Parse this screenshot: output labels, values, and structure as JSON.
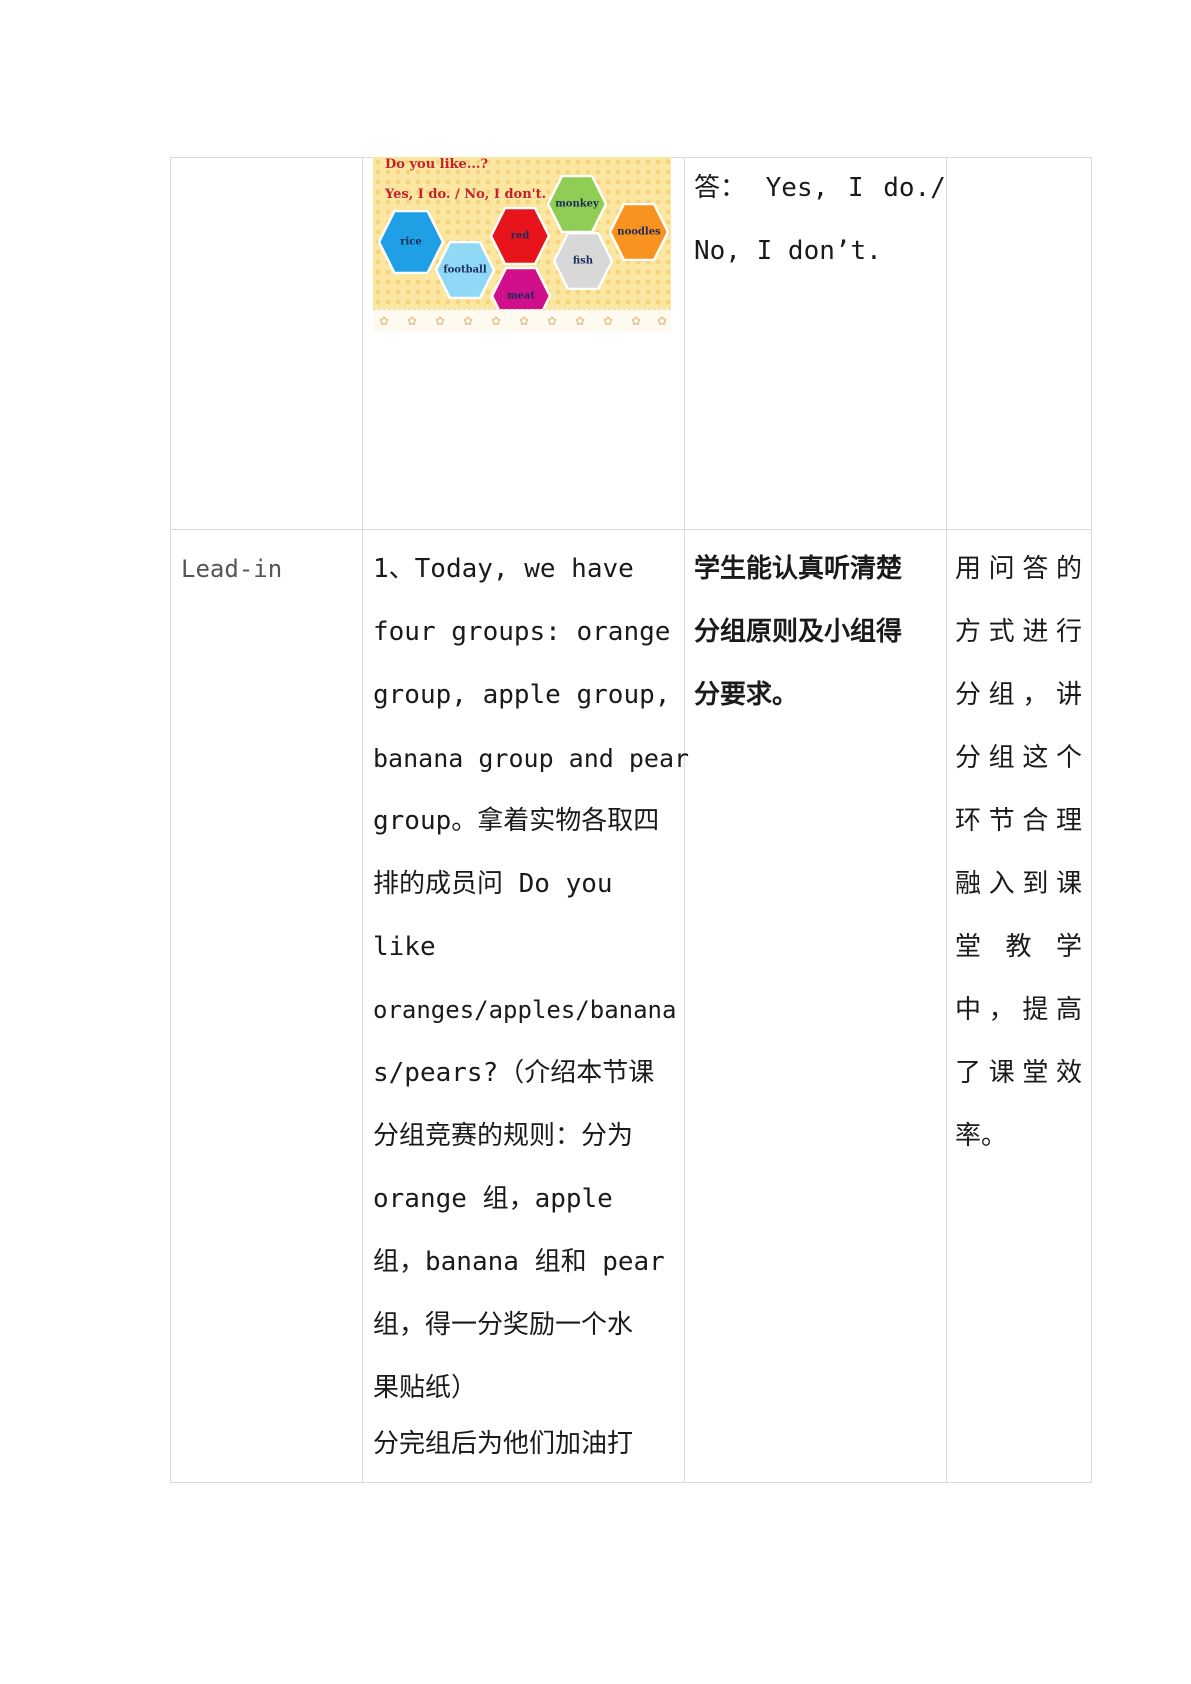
{
  "table": {
    "row1": {
      "slide": {
        "question": "Do you like...?",
        "answers_line": "Yes, I do. / No, I don't.",
        "hexagons": [
          {
            "label": "rice",
            "color": "#1e9fe6"
          },
          {
            "label": "football",
            "color": "#8fd8f6"
          },
          {
            "label": "red",
            "color": "#e8141c"
          },
          {
            "label": "meat",
            "color": "#d10f8a"
          },
          {
            "label": "monkey",
            "color": "#8fcd55"
          },
          {
            "label": "fish",
            "color": "#d8d8d8"
          },
          {
            "label": "noodles",
            "color": "#f7931e"
          }
        ]
      },
      "col3_lines": [
        "答： Yes,  I  do./",
        "No, I don’t."
      ]
    },
    "row2": {
      "stage": "Lead-in",
      "activity_lines": [
        "1、Today,  we  have",
        "four groups: orange",
        "group,  apple group,",
        "banana group and pear",
        "group。拿着实物各取四",
        "排的成员问 Do  you",
        "like",
        "oranges/apples/banana",
        "s/pears?（介绍本节课",
        "分组竞赛的规则：分为",
        "orange 组，apple",
        "组，banana 组和 pear",
        "组，得一分奖励一个水",
        "果贴纸）",
        "分完组后为他们加油打"
      ],
      "student_lines": [
        "学生能认真听清楚",
        "分组原则及小组得",
        "分要求。"
      ],
      "purpose_lines": [
        "用问答的",
        "方式进行",
        "分组，讲",
        "分组这个",
        "环节合理",
        "融入到课",
        "堂 教 学",
        "中，提高",
        "了课堂效",
        "率。"
      ]
    }
  }
}
